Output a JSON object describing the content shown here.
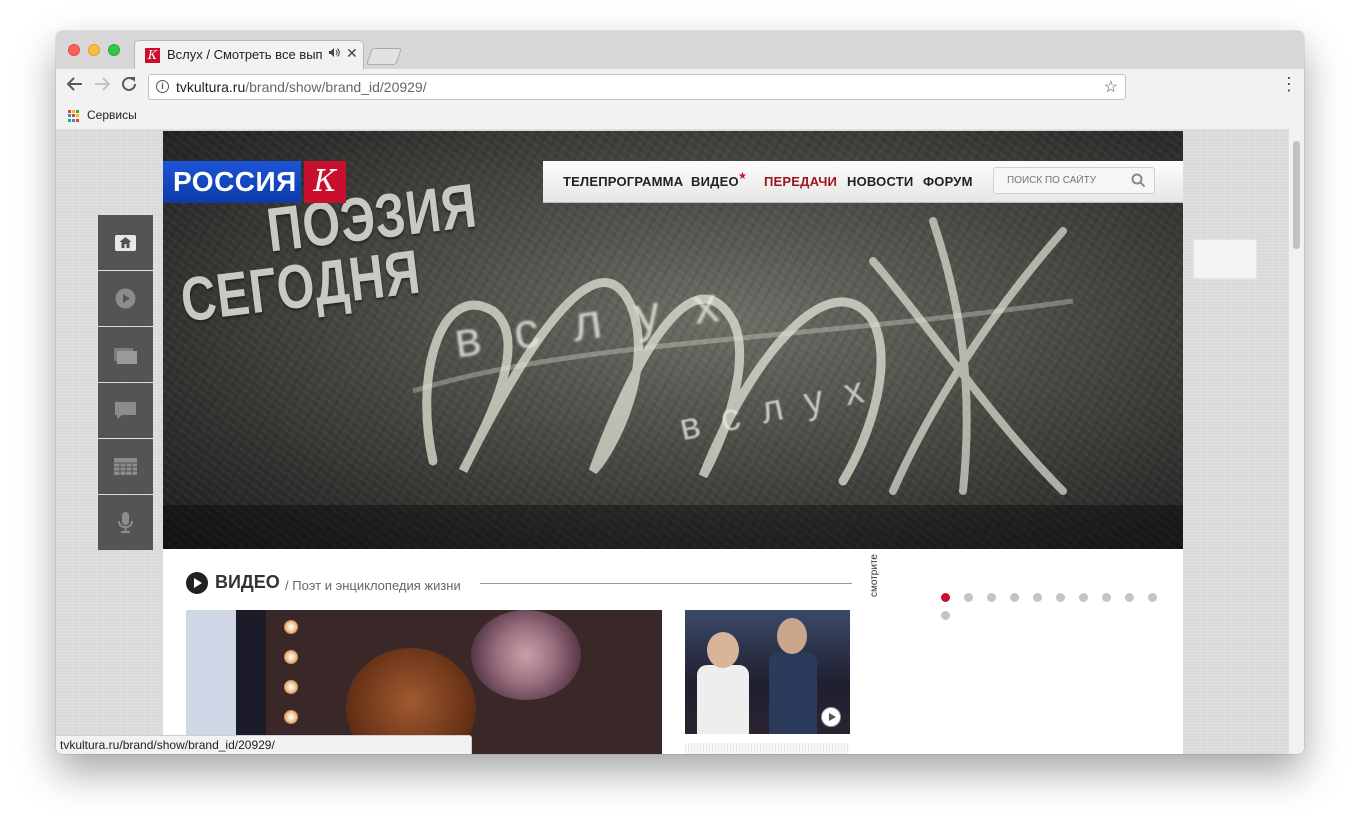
{
  "browser": {
    "tab": {
      "favicon_letter": "К",
      "title": "Вслух / Смотреть все вып",
      "audio_icon": "speaker-icon",
      "close_glyph": "✕"
    },
    "url": {
      "host": "tvkultura.ru",
      "path": "/brand/show/brand_id/20929/"
    },
    "bookmarks": [
      {
        "label": "Сервисы",
        "icon": "apps-grid-icon"
      }
    ],
    "status_url": "tvkultura.ru/brand/show/brand_id/20929/",
    "colors": {
      "apps": [
        "#ea4335",
        "#fbbc05",
        "#34a853",
        "#4285f4",
        "#ea4335",
        "#fbbc05",
        "#34a853",
        "#4285f4",
        "#ea4335"
      ]
    }
  },
  "site": {
    "logo_main": "РОССИЯ",
    "logo_k": "К",
    "nav": [
      {
        "label": "ТЕЛЕПРОГРАММА"
      },
      {
        "label": "ВИДЕО",
        "star": "★"
      },
      {
        "label": "ПЕРЕДАЧИ",
        "active": true
      },
      {
        "label": "НОВОСТИ"
      },
      {
        "label": "ФОРУМ"
      }
    ],
    "search_placeholder": "ПОИСК ПО САЙТУ",
    "sidebar_icons": [
      "home-icon",
      "play-icon",
      "gallery-icon",
      "comments-icon",
      "schedule-icon",
      "microphone-icon"
    ],
    "hero": {
      "line1": "ПОЭЗИЯ",
      "line2": "СЕГОДНЯ",
      "chalk1": "вслух",
      "chalk2": "вслух"
    },
    "video_section": {
      "title": "ВИДЕО",
      "subtitle": "/ Поэт и энциклопедия жизни"
    },
    "watch_label": "смотрите",
    "carousel": {
      "count": 11,
      "active_index": 0
    },
    "colors": {
      "brand_red": "#c8102e",
      "brand_blue": "#1d55d8",
      "active_nav": "#a0141e"
    }
  }
}
